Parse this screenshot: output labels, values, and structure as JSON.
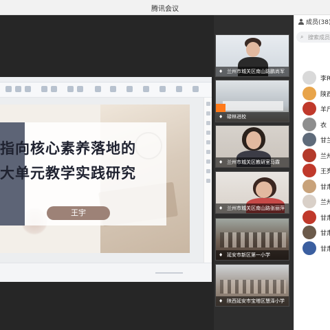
{
  "window": {
    "title": "腾讯会议"
  },
  "slide": {
    "title_line1": "指向核心素养落地的",
    "title_line2": "大单元教学实践研究",
    "presenter": "王宇"
  },
  "videos": [
    {
      "caption": "兰州市城关区南山路鹏尚军"
    },
    {
      "caption": "碌林进校"
    },
    {
      "caption": "兰州市城关区教研室马霖"
    },
    {
      "caption": "兰州市城关区南山路张丽萍"
    },
    {
      "caption": "延安市新区第一小学"
    },
    {
      "caption": "陕西延安市宝塔区慧泽小学"
    }
  ],
  "members_panel": {
    "header": "成员(38)",
    "search_placeholder": "搜索成员",
    "items": [
      {
        "name": "李R",
        "color": "#d9d9d9"
      },
      {
        "name": "陕西",
        "color": "#e8a44a"
      },
      {
        "name": "羊斤",
        "color": "#c0392b"
      },
      {
        "name": "衣",
        "color": "#8e8e8e"
      },
      {
        "name": "甘兰",
        "color": "#5f6b7a"
      },
      {
        "name": "兰州",
        "color": "#b33a2a"
      },
      {
        "name": "王亮",
        "color": "#c0392b"
      },
      {
        "name": "甘肃",
        "color": "#c8a27a"
      },
      {
        "name": "兰州",
        "color": "#d9d0c8"
      },
      {
        "name": "甘肃",
        "color": "#c0392b"
      },
      {
        "name": "甘肃",
        "color": "#6b5a4a"
      },
      {
        "name": "甘肃",
        "color": "#3b5fa0"
      }
    ]
  }
}
